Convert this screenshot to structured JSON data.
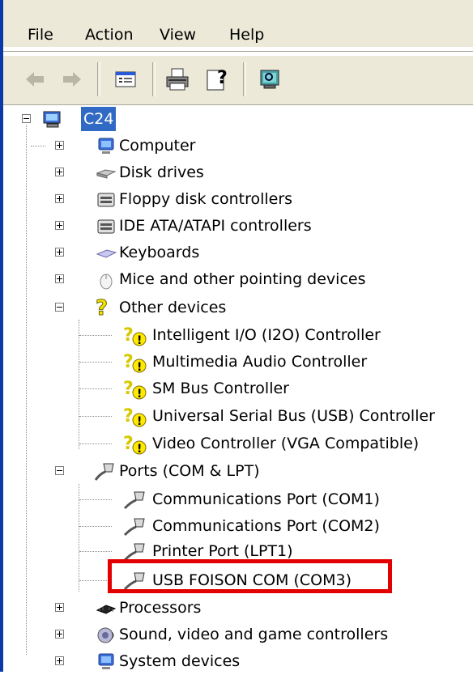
{
  "menu": [
    "File",
    "Action",
    "View",
    "Help"
  ],
  "toolbar": {
    "buttons": [
      "back-icon",
      "forward-icon",
      "properties-icon",
      "print-icon",
      "help-icon",
      "scan-hardware-icon"
    ]
  },
  "tree": {
    "root": {
      "label": "C24",
      "icon": "computer-icon"
    },
    "categories": [
      {
        "label": "Computer",
        "icon": "computer-icon",
        "expanded": false
      },
      {
        "label": "Disk drives",
        "icon": "disk-drive-icon",
        "expanded": false
      },
      {
        "label": "Floppy disk controllers",
        "icon": "controller-icon",
        "expanded": false
      },
      {
        "label": "IDE ATA/ATAPI controllers",
        "icon": "controller-icon",
        "expanded": false
      },
      {
        "label": "Keyboards",
        "icon": "keyboard-icon",
        "expanded": false
      },
      {
        "label": "Mice and other pointing devices",
        "icon": "mouse-icon",
        "expanded": false
      },
      {
        "label": "Other devices",
        "icon": "unknown-device-icon",
        "expanded": true,
        "children": [
          "Intelligent I/O (I2O) Controller",
          "Multimedia Audio Controller",
          "SM Bus Controller",
          "Universal Serial Bus (USB) Controller",
          "Video Controller (VGA Compatible)"
        ]
      },
      {
        "label": "Ports (COM & LPT)",
        "icon": "port-icon",
        "expanded": true,
        "children": [
          "Communications Port (COM1)",
          "Communications Port (COM2)",
          "Printer Port (LPT1)",
          "USB FOISON COM (COM3)"
        ]
      },
      {
        "label": "Processors",
        "icon": "processor-icon",
        "expanded": false
      },
      {
        "label": "Sound, video and game controllers",
        "icon": "sound-icon",
        "expanded": false
      },
      {
        "label": "System devices",
        "icon": "system-device-icon",
        "expanded": false
      }
    ]
  },
  "highlighted_item": "USB FOISON COM (COM3)",
  "colors": {
    "selection": "#316ac5",
    "highlight_border": "#e20000",
    "window_border": "#0b3aa8"
  }
}
